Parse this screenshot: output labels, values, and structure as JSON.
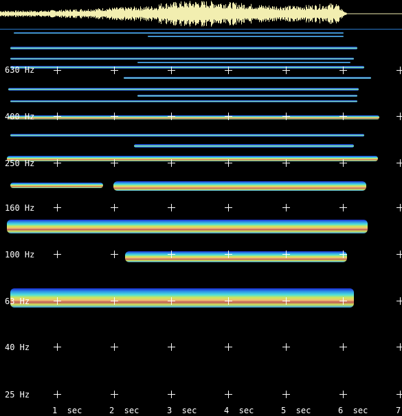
{
  "colors": {
    "background": "#000000",
    "waveform": "#f2eeb0",
    "divider": "#2a7acc",
    "labels": "#ffffff",
    "colormap": [
      "#1a2ad0",
      "#2f9be8",
      "#52e0d8",
      "#cfe65a",
      "#f0c070",
      "#c05a58"
    ]
  },
  "frequency_labels": [
    "630 Hz",
    "400 Hz",
    "250 Hz",
    "160 Hz",
    "100 Hz",
    "63 Hz",
    "40 Hz",
    "25 Hz"
  ],
  "time_labels": [
    "1 sec",
    "2 sec",
    "3 sec",
    "4 sec",
    "5 sec",
    "6 sec",
    "7"
  ]
}
